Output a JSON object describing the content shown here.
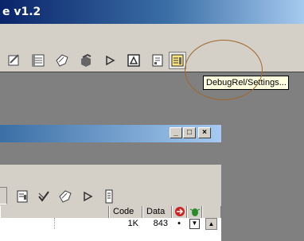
{
  "app": {
    "title": "e v1.2"
  },
  "main_toolbar": {
    "icons": [
      "edit-icon",
      "list-icon",
      "tag-icon",
      "component-icon",
      "play-icon",
      "chip-icon",
      "document-icon",
      "debugrel-settings-icon"
    ]
  },
  "tooltip": {
    "text": "DebugRel/Settings..."
  },
  "child_window": {
    "controls": {
      "minimize": "_",
      "maximize": "□",
      "close": "×"
    },
    "toolbar_icons": [
      "settings-doc-icon",
      "check-icon",
      "tag-icon",
      "play-icon",
      "device-icon"
    ],
    "columns": [
      "Code",
      "Data"
    ],
    "row": {
      "code": "1K",
      "data": "843",
      "bullet": "•"
    }
  },
  "colors": {
    "titlebar_start": "#0a246a",
    "titlebar_end": "#a6caf0",
    "face": "#d4d0c8",
    "tooltip_bg": "#ffffe1",
    "highlight_circle": "#a0662a"
  }
}
